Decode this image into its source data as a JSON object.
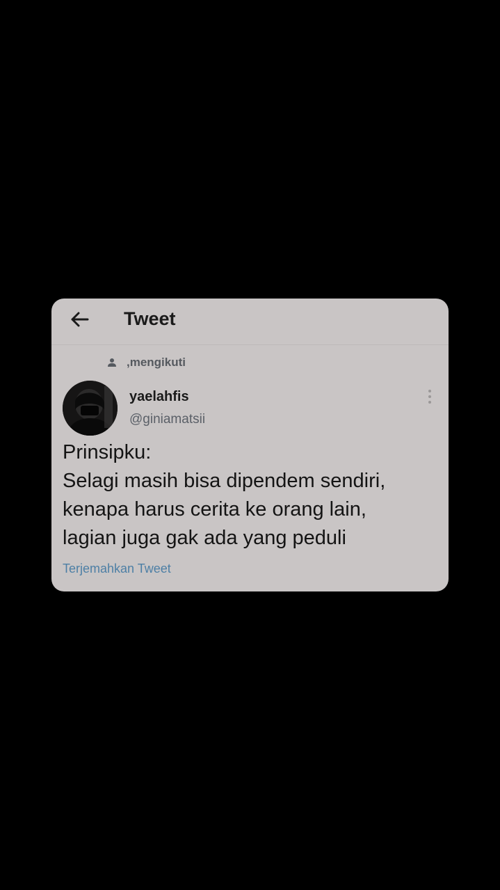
{
  "header": {
    "title": "Tweet",
    "back_icon": "arrow-left-icon"
  },
  "social_context": {
    "icon": "person-icon",
    "text": ",mengikuti"
  },
  "author": {
    "display_name": "yaelahfis",
    "handle": "@giniamatsii",
    "avatar": "dark profile photo"
  },
  "tweet": {
    "lines": [
      "Prinsipku:",
      "Selagi masih bisa dipendem sendiri,",
      "kenapa harus cerita ke orang lain,",
      "lagian juga gak ada yang peduli"
    ]
  },
  "translate_label": "Terjemahkan Tweet",
  "colors": {
    "background": "#000000",
    "card": "#c9c5c5",
    "link": "#4d7fa5",
    "text": "#141414",
    "muted": "#5b6068"
  }
}
